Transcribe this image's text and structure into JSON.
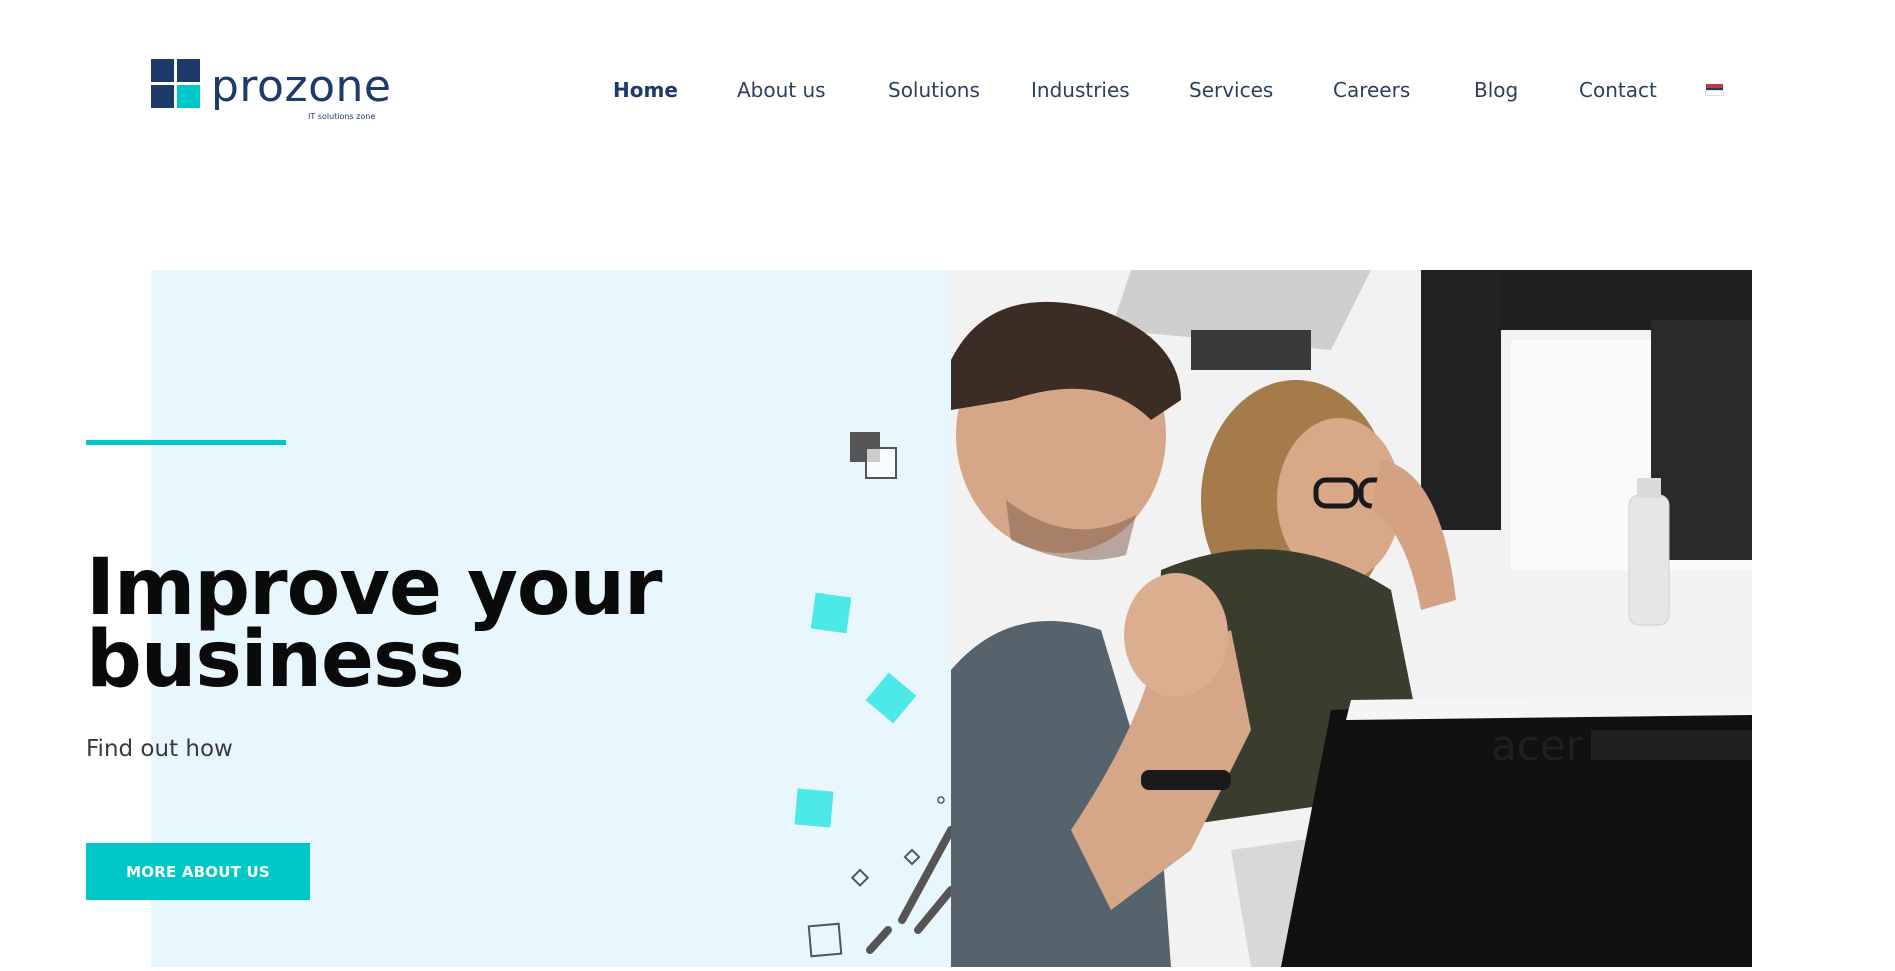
{
  "brand": {
    "name": "prozone",
    "tagline": "IT solutions zone",
    "colors": {
      "navy": "#1d3a6b",
      "teal": "#00c8c8",
      "hero_bg": "#e8f7fe",
      "confetti": "#4de8e8"
    }
  },
  "nav": {
    "items": [
      {
        "label": "Home",
        "active": true
      },
      {
        "label": "About us",
        "active": false
      },
      {
        "label": "Solutions",
        "active": false
      },
      {
        "label": "Industries",
        "active": false
      },
      {
        "label": "Services",
        "active": false
      },
      {
        "label": "Careers",
        "active": false
      },
      {
        "label": "Blog",
        "active": false
      },
      {
        "label": "Contact",
        "active": false
      }
    ],
    "language_icon": "serbia-flag-icon"
  },
  "hero": {
    "title_line1": "Improve your",
    "title_line2": "business",
    "subtitle": "Find out how",
    "cta_label": "MORE ABOUT US",
    "photo_icon": "team-photo"
  }
}
